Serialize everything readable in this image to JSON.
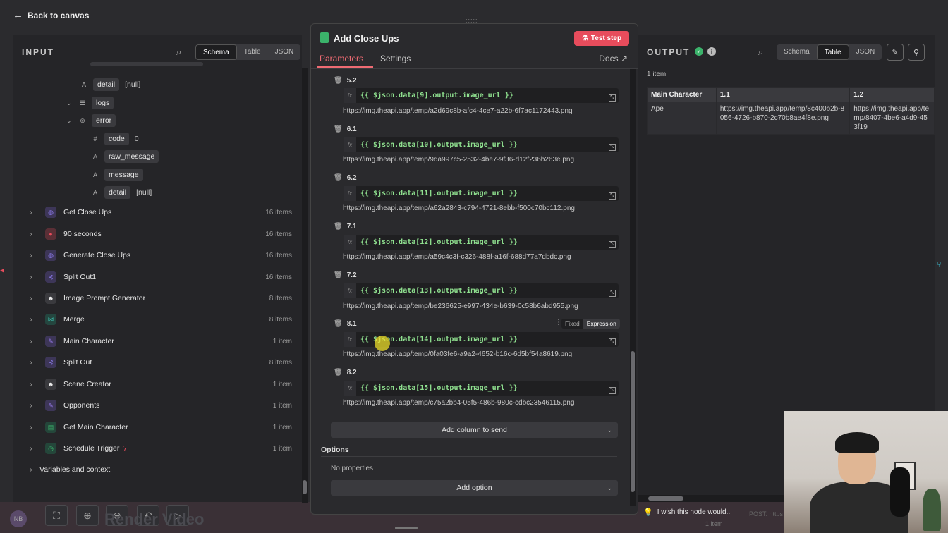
{
  "top": {
    "back_label": "Back to canvas"
  },
  "input_panel": {
    "title": "INPUT",
    "view_tabs": [
      "Schema",
      "Table",
      "JSON"
    ],
    "schema_rows": [
      {
        "type": "A",
        "key": "detail",
        "value": "[null]"
      },
      {
        "type": "list",
        "key": "logs",
        "value": ""
      },
      {
        "type": "obj",
        "key": "error",
        "value": ""
      },
      {
        "type": "#",
        "key": "code",
        "value": "0"
      },
      {
        "type": "A",
        "key": "raw_message",
        "value": ""
      },
      {
        "type": "A",
        "key": "message",
        "value": ""
      },
      {
        "type": "A",
        "key": "detail",
        "value": "[null]"
      }
    ],
    "nodes": [
      {
        "name": "Get Close Ups",
        "count": "16 items",
        "color": "#6b5bd6"
      },
      {
        "name": "90 seconds",
        "count": "16 items",
        "color": "#e74c5c"
      },
      {
        "name": "Generate Close Ups",
        "count": "16 items",
        "color": "#6b5bd6"
      },
      {
        "name": "Split Out1",
        "count": "16 items",
        "color": "#6b5bd6"
      },
      {
        "name": "Image Prompt Generator",
        "count": "8 items",
        "color": "#e6e6e6"
      },
      {
        "name": "Merge",
        "count": "8 items",
        "color": "#3bb3a4"
      },
      {
        "name": "Main Character",
        "count": "1 item",
        "color": "#7d5bd6"
      },
      {
        "name": "Split Out",
        "count": "8 items",
        "color": "#6b5bd6"
      },
      {
        "name": "Scene Creator",
        "count": "1 item",
        "color": "#e6e6e6"
      },
      {
        "name": "Opponents",
        "count": "1 item",
        "color": "#7d5bd6"
      },
      {
        "name": "Get Main Character",
        "count": "1 item",
        "color": "#3bb36b"
      },
      {
        "name": "Schedule Trigger",
        "count": "1 item",
        "color": "#3bb36b"
      }
    ],
    "variables_label": "Variables and context"
  },
  "modal": {
    "title": "Add Close Ups",
    "test_step_label": "Test step",
    "tabs": [
      "Parameters",
      "Settings"
    ],
    "docs_label": "Docs",
    "fields": [
      {
        "label": "5.2",
        "expr": "{{ $json.data[9].output.image_url }}",
        "url": "https://img.theapi.app/temp/a2d69c8b-afc4-4ce7-a22b-6f7ac1172443.png"
      },
      {
        "label": "6.1",
        "expr": "{{ $json.data[10].output.image_url }}",
        "url": "https://img.theapi.app/temp/9da997c5-2532-4be7-9f36-d12f236b263e.png"
      },
      {
        "label": "6.2",
        "expr": "{{ $json.data[11].output.image_url }}",
        "url": "https://img.theapi.app/temp/a62a2843-c794-4721-8ebb-f500c70bc112.png"
      },
      {
        "label": "7.1",
        "expr": "{{ $json.data[12].output.image_url }}",
        "url": "https://img.theapi.app/temp/a59c4c3f-c326-488f-a16f-688d77a7dbdc.png"
      },
      {
        "label": "7.2",
        "expr": "{{ $json.data[13].output.image_url }}",
        "url": "https://img.theapi.app/temp/be236625-e997-434e-b639-0c58b6abd955.png"
      },
      {
        "label": "8.1",
        "expr": "{{ $json.data[14].output.image_url }}",
        "url": "https://img.theapi.app/temp/0fa03fe6-a9a2-4652-b16c-6d5bf54a8619.png"
      },
      {
        "label": "8.2",
        "expr": "{{ $json.data[15].output.image_url }}",
        "url": "https://img.theapi.app/temp/c75a2bb4-05f5-486b-980c-cdbc23546115.png"
      }
    ],
    "mode_toggle": [
      "Fixed",
      "Expression"
    ],
    "add_column_label": "Add column to send",
    "options_label": "Options",
    "no_properties": "No properties",
    "add_option_label": "Add option"
  },
  "output_panel": {
    "title": "OUTPUT",
    "view_tabs": [
      "Schema",
      "Table",
      "JSON"
    ],
    "item_count": "1 item",
    "table": {
      "headers": [
        "Main Character",
        "1.1",
        "1.2"
      ],
      "row": [
        "Ape",
        "https://img.theapi.app/temp/8c400b2b-8056-4726-b870-2c70b8ae4f8e.png",
        "https://img.theapi.app/temp/8407-4be6-a4d9-453f19"
      ]
    }
  },
  "bottom": {
    "canvas_node_label": "Render Video",
    "wish_label": "I wish this node would...",
    "item_label": "1 item",
    "post_hint": "POST: https"
  }
}
